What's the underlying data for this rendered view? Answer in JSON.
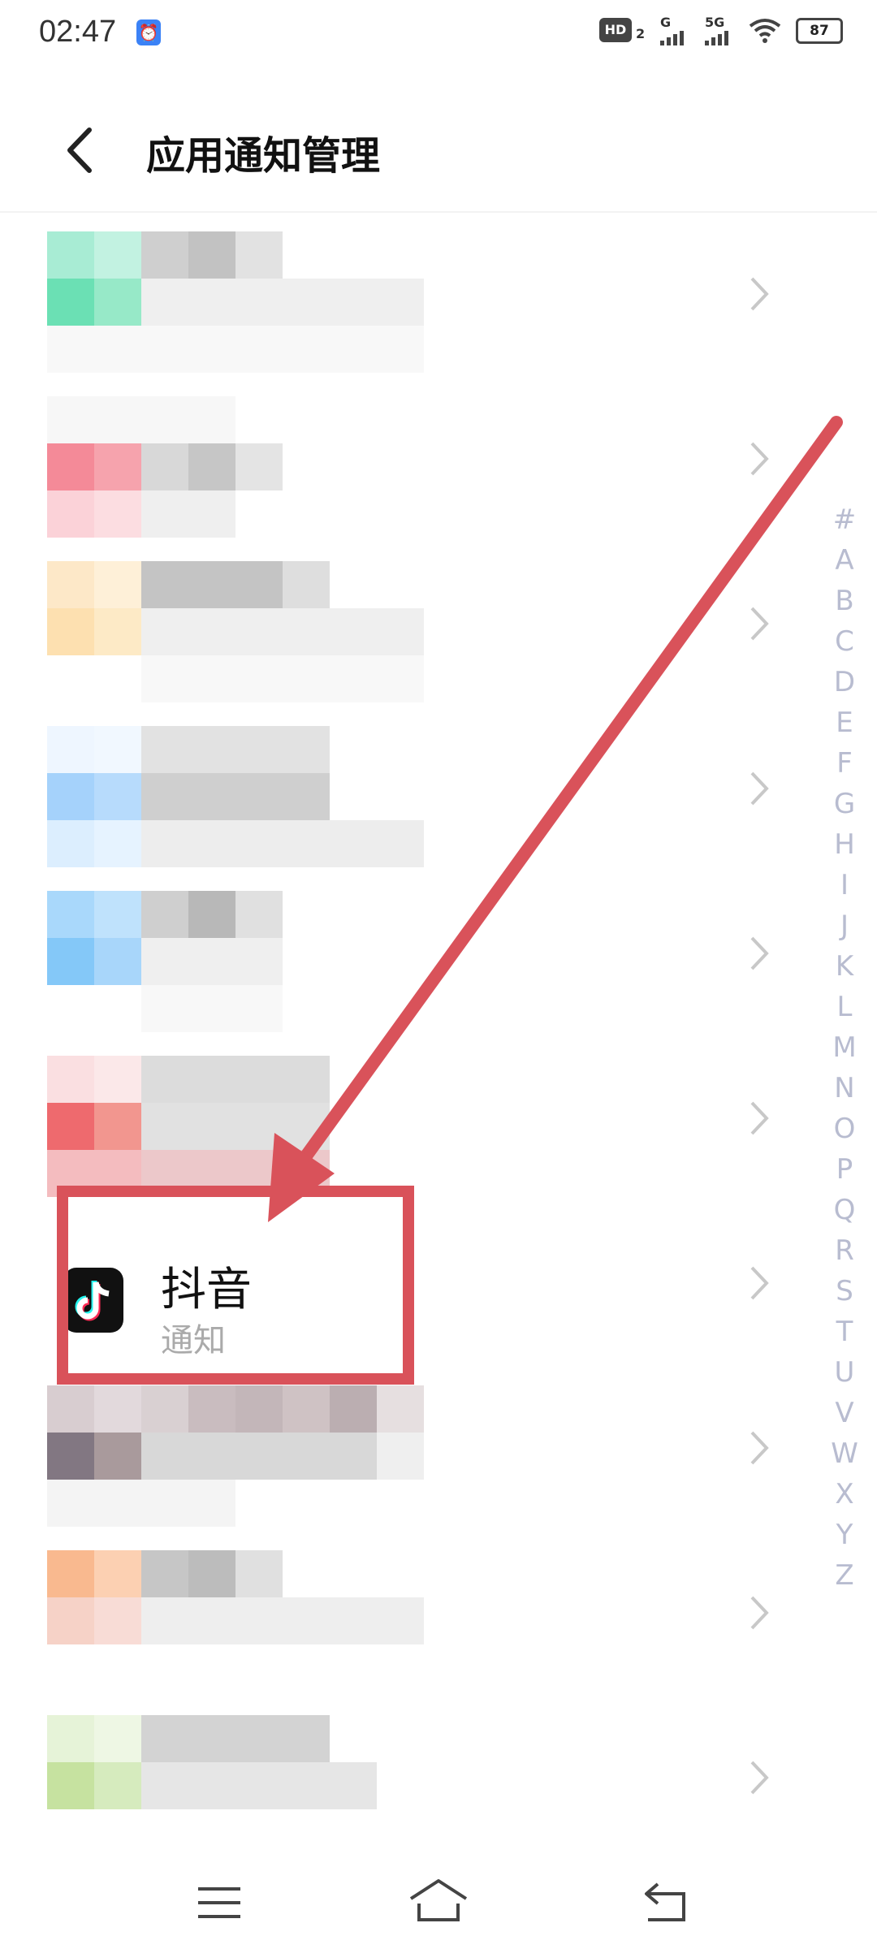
{
  "status_bar": {
    "time": "02:47",
    "hd_label": "HD",
    "hd_sub": "2",
    "sim1_label": "G",
    "sim2_label": "5G",
    "battery": "87",
    "icons": [
      "alarm-icon",
      "signal-icon",
      "wifi-icon",
      "battery-icon"
    ]
  },
  "header": {
    "title": "应用通知管理",
    "back_icon": "chevron-left-icon"
  },
  "apps": [
    {
      "name": "",
      "sub": "",
      "obscured": true
    },
    {
      "name": "",
      "sub": "",
      "obscured": true
    },
    {
      "name": "",
      "sub": "",
      "obscured": true
    },
    {
      "name": "",
      "sub": "",
      "obscured": true
    },
    {
      "name": "",
      "sub": "",
      "obscured": true
    },
    {
      "name": "",
      "sub": "",
      "obscured": true
    },
    {
      "name": "抖音",
      "sub": "通知",
      "obscured": false,
      "icon": "tiktok-icon"
    },
    {
      "name": "",
      "sub": "",
      "obscured": true
    },
    {
      "name": "",
      "sub": "",
      "obscured": true
    },
    {
      "name": "",
      "sub": "",
      "obscured": true
    }
  ],
  "alphabet_index": [
    "#",
    "A",
    "B",
    "C",
    "D",
    "E",
    "F",
    "G",
    "H",
    "I",
    "J",
    "K",
    "L",
    "M",
    "N",
    "O",
    "P",
    "Q",
    "R",
    "S",
    "T",
    "U",
    "V",
    "W",
    "X",
    "Y",
    "Z"
  ],
  "colors": {
    "annotation": "#d9525a",
    "index_text": "#b8bcd0",
    "chevron": "#c8c8c8"
  },
  "nav": {
    "icons": [
      "menu-icon",
      "home-icon",
      "back-icon"
    ]
  }
}
